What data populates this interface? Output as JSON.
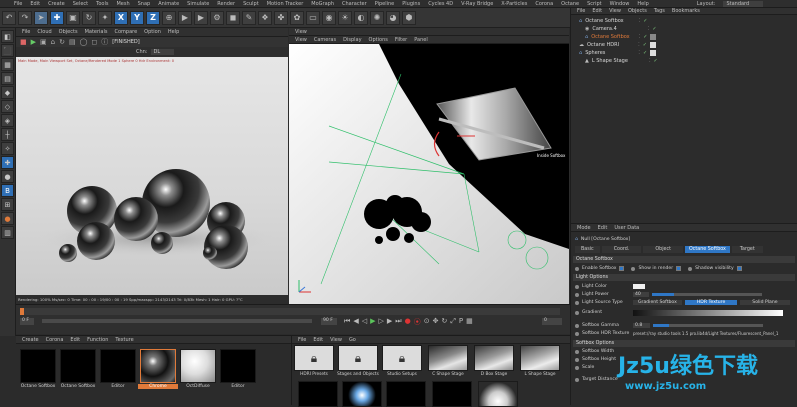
{
  "menubar": {
    "items": [
      "File",
      "Edit",
      "Create",
      "Select",
      "Tools",
      "Mesh",
      "Snap",
      "Animate",
      "Simulate",
      "Render",
      "Sculpt",
      "Motion Tracker",
      "MoGraph",
      "Character",
      "Pipeline",
      "Plugins",
      "Cycles 4D",
      "V-Ray Bridge",
      "X-Particles",
      "Corona",
      "Octane",
      "Script",
      "Window",
      "Help"
    ],
    "layout_label": "Layout:",
    "layout_value": "Standard"
  },
  "toolbar": {
    "x_label": "X",
    "y_label": "Y",
    "z_label": "Z"
  },
  "picture_viewer": {
    "menu": [
      "File",
      "Cloud",
      "Objects",
      "Materials",
      "Compare",
      "Option",
      "Help"
    ],
    "status": "[FINISHED]",
    "chn_label": "Chn:",
    "chn_value": "DL",
    "info": "Rendering: 100%  Ms/sec: 0   Time: 00 : 00 : 19/00 : 00 : 19   Spp/maxspp: 2143/2143   Tri: 0/83k   Mesh: 1   Hair: 0   GPU:   ?°C",
    "overlay": "Main Mode, Main Viewport Set, Octane/Rendered Mode 1 Sphere 0 Hdr Environment: 0"
  },
  "viewport": {
    "tab": "View",
    "menu": [
      "View",
      "Cameras",
      "Display",
      "Options",
      "Filter",
      "Panel"
    ],
    "camera_label": "Inside Softbox"
  },
  "object_manager": {
    "menu": [
      "File",
      "Edit",
      "View",
      "Objects",
      "Tags",
      "Bookmarks"
    ],
    "objects": [
      {
        "name": "Octane Softbox",
        "color": "#e6e6e6"
      },
      {
        "name": "Camera.4",
        "color": "#e6e6e6"
      },
      {
        "name": "Octane Softbox",
        "color": "#e07a3a"
      },
      {
        "name": "Octane HDRI",
        "color": "#e6e6e6"
      },
      {
        "name": "Spheres",
        "color": "#e6e6e6"
      },
      {
        "name": "L Shape Stage",
        "color": "#e6e6e6"
      }
    ]
  },
  "attributes": {
    "menu": [
      "Mode",
      "Edit",
      "User Data"
    ],
    "object_title": "Null [Octane Softbox]",
    "tabs": [
      "Basic",
      "Coord.",
      "Object",
      "Octane Softbox",
      "Target"
    ],
    "section_main": "Octane Softbox",
    "enable_softbox": "Enable Softbox",
    "show_in_render": "Show in render",
    "shadow_visibility": "Shadow visibility",
    "section_light": "Light Options",
    "light_color": "Light Color",
    "light_power": "Light Power",
    "light_power_value": "40",
    "light_source_type": "Light Source Type",
    "lst_options": [
      "Gradient Softbox",
      "HDR Texture",
      "Solid Plane"
    ],
    "gradient": "Gradient",
    "softbox_gamma": "Softbox Gamma",
    "softbox_gamma_value": "0.8",
    "softbox_hdr_texture": "Softbox HDR Texture",
    "hdr_path": "preset://ray studio tools 1.5 pro.lib4d/Light Textures/Fluorescent_Panel_1",
    "section_softbox": "Softbox Options",
    "softbox_width": "Softbox Width",
    "softbox_height": "Softbox Height",
    "scale": "Scale",
    "target_distance": "Target Distance"
  },
  "timeline": {
    "start_frame": "0 F",
    "end_frame": "90 F",
    "current_frame": "0"
  },
  "material_manager": {
    "menu": [
      "Create",
      "Corona",
      "Edit",
      "Function",
      "Texture"
    ],
    "materials": [
      "Octane Softbox",
      "Octane Softbox",
      "Editor",
      "Chrome",
      "OctDiffuse",
      "Editor"
    ]
  },
  "content_browser": {
    "menu": [
      "File",
      "Edit",
      "View",
      "Go"
    ],
    "row1": [
      "HDRI Presets",
      "Stages and Objects",
      "Studio Setups",
      "C Shape Stage",
      "D Box Stage",
      "L Shape Stage"
    ]
  },
  "watermark": {
    "line1": "Jz5u绿色下载",
    "line2": "www.jz5u.com"
  }
}
